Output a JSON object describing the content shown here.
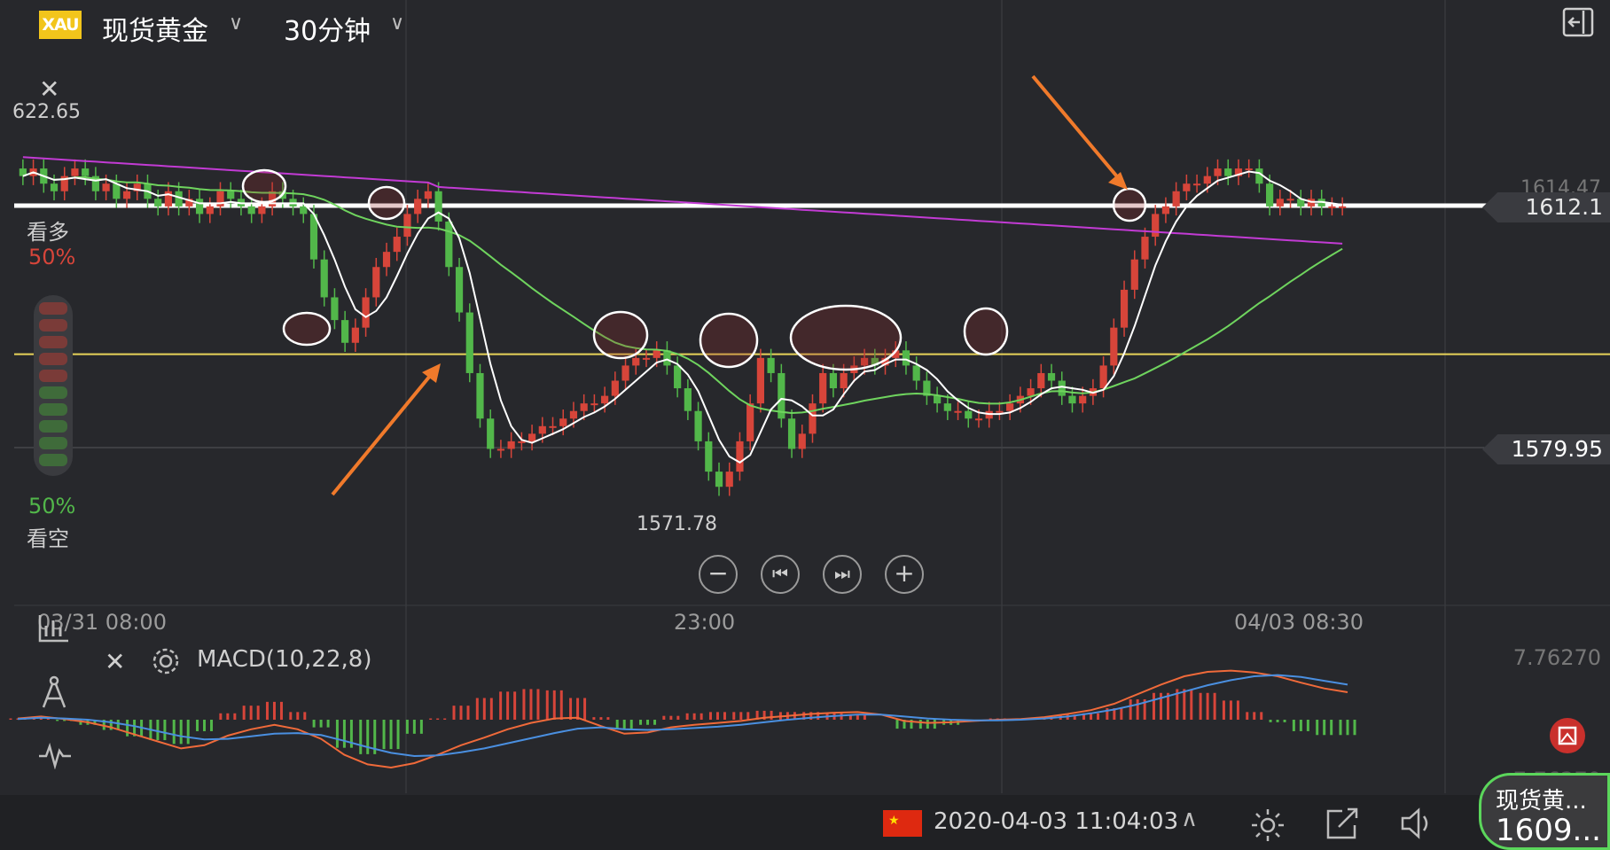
{
  "header": {
    "logo_text": "XAU",
    "symbol": "现货黄金",
    "period": "30分钟"
  },
  "overlay_labels": {
    "high_marker": "622.65",
    "close_x": "✕",
    "bull_label": "看多",
    "bull_pct": "50%",
    "bear_pct": "50%",
    "bear_label": "看空",
    "low_marker": "1571.78"
  },
  "price_boxes": {
    "upper": "1614.47",
    "current": "1612.1",
    "lower": "1579.95"
  },
  "time_labels": [
    "03/31 08:00",
    "23:00",
    "04/03 08:30"
  ],
  "controls": [
    "−",
    "⏮",
    "⏭",
    "+"
  ],
  "macd": {
    "title": "MACD(10,22,8)",
    "axis_top": "7.76270",
    "axis_bottom": "-7.76270"
  },
  "status_bar": {
    "datetime": "2020-04-03 11:04:03",
    "widget_title": "现货黄...",
    "widget_price": "1609..."
  },
  "colors": {
    "up": "#d7453a",
    "down": "#52b74a",
    "ma_white": "#ffffff",
    "ma_green": "#6fd45e",
    "ma_purple": "#c23bd4",
    "yellow_line": "#e8d35a",
    "arrow": "#f07a2b"
  },
  "chart_data": {
    "type": "candlestick",
    "title": "",
    "y_labels_shown": [
      "1614.47",
      "1612.1",
      "1579.95",
      "1571.78",
      "622.65"
    ],
    "x_labels": [
      "03/31 08:00",
      "23:00",
      "04/03 08:30"
    ],
    "closes": [
      1616,
      1617,
      1615,
      1614,
      1616,
      1617,
      1616,
      1614,
      1615,
      1613,
      1614,
      1615,
      1613,
      1612,
      1614,
      1612,
      1613,
      1611,
      1612,
      1614,
      1613,
      1612,
      1611,
      1612,
      1614,
      1613,
      1612,
      1611,
      1605,
      1600,
      1597,
      1594,
      1596,
      1600,
      1604,
      1606,
      1608,
      1611,
      1613,
      1614,
      1610,
      1604,
      1598,
      1590,
      1584,
      1580,
      1580,
      1581,
      1581,
      1582,
      1583,
      1583,
      1584,
      1585,
      1586,
      1586,
      1587,
      1589,
      1591,
      1592,
      1592,
      1593,
      1591,
      1588,
      1585,
      1581,
      1577,
      1575,
      1577,
      1581,
      1586,
      1592,
      1590,
      1584,
      1580,
      1582,
      1586,
      1590,
      1588,
      1590,
      1591,
      1592,
      1591,
      1592,
      1593,
      1591,
      1589,
      1587,
      1586,
      1585,
      1585,
      1584,
      1584,
      1585,
      1585,
      1586,
      1587,
      1588,
      1590,
      1589,
      1587,
      1586,
      1587,
      1588,
      1591,
      1596,
      1601,
      1605,
      1608,
      1611,
      1612,
      1614,
      1615,
      1615,
      1616,
      1617,
      1616,
      1617,
      1617,
      1615,
      1612,
      1613,
      1613,
      1612,
      1613,
      1612,
      1612,
      1612
    ],
    "ma_white_last": 1612.1,
    "horizontal_levels": [
      1612.1,
      1592.5
    ],
    "macd": {
      "dif": [
        0.2,
        0.5,
        0.1,
        -0.4,
        -1.2,
        -2.3,
        -3.4,
        -4.5,
        -4.0,
        -2.5,
        -1.5,
        -0.8,
        -1.5,
        -3.0,
        -5.5,
        -7.0,
        -7.5,
        -6.8,
        -5.5,
        -4.0,
        -2.8,
        -1.5,
        -0.5,
        0.2,
        0.3,
        -1.0,
        -2.2,
        -2.0,
        -1.2,
        -0.8,
        -0.5,
        -0.2,
        0.3,
        0.6,
        0.9,
        1.1,
        1.2,
        0.8,
        -0.2,
        -0.5,
        -0.4,
        -0.2,
        0.0,
        0.1,
        0.4,
        0.9,
        1.5,
        2.5,
        4.0,
        5.5,
        6.8,
        7.5,
        7.7,
        7.4,
        6.8,
        5.8,
        4.9,
        4.3
      ],
      "dea": [
        0.1,
        0.3,
        0.2,
        0.0,
        -0.4,
        -1.0,
        -1.8,
        -2.6,
        -3.1,
        -3.0,
        -2.6,
        -2.2,
        -2.1,
        -2.4,
        -3.3,
        -4.3,
        -5.2,
        -5.7,
        -5.6,
        -5.1,
        -4.5,
        -3.7,
        -2.9,
        -2.1,
        -1.4,
        -1.2,
        -1.5,
        -1.6,
        -1.5,
        -1.3,
        -1.1,
        -0.8,
        -0.4,
        0.0,
        0.3,
        0.6,
        0.8,
        0.8,
        0.5,
        0.2,
        0.0,
        -0.1,
        -0.1,
        0.0,
        0.2,
        0.5,
        1.0,
        1.6,
        2.4,
        3.4,
        4.4,
        5.4,
        6.2,
        6.8,
        7.0,
        6.7,
        6.1,
        5.5
      ]
    }
  }
}
